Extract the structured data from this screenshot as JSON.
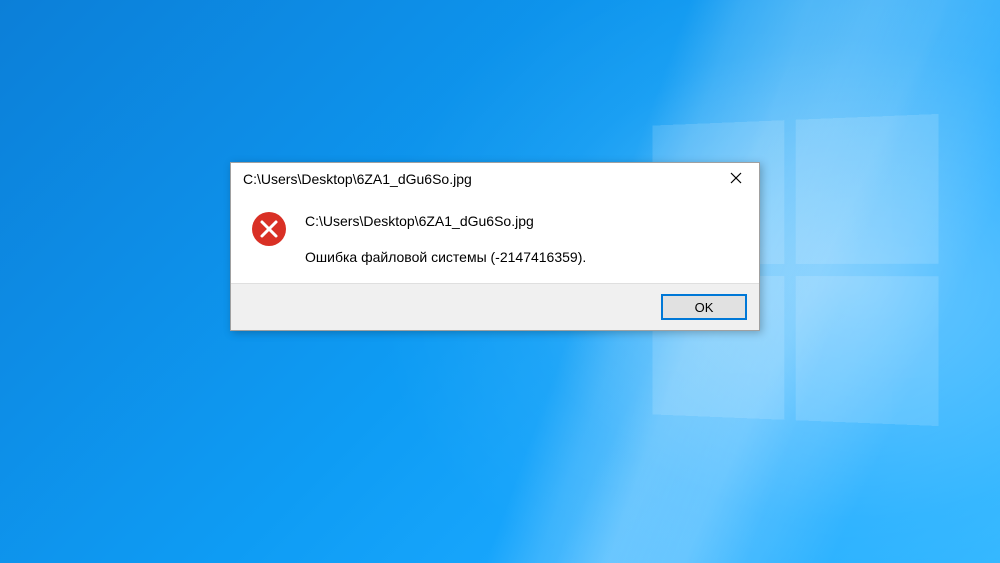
{
  "dialog": {
    "title": "C:\\Users\\Desktop\\6ZA1_dGu6So.jpg",
    "message_path": "C:\\Users\\Desktop\\6ZA1_dGu6So.jpg",
    "message_error": "Ошибка файловой системы (-2147416359).",
    "ok_label": "OK",
    "close_label": "✕",
    "icon": "error-icon"
  }
}
